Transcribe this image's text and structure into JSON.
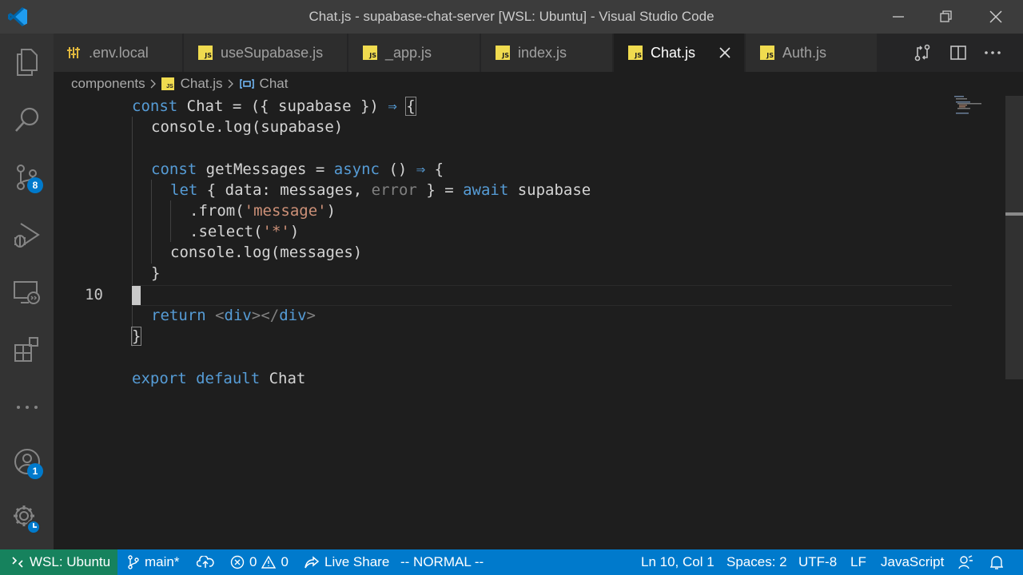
{
  "window": {
    "title": "Chat.js - supabase-chat-server [WSL: Ubuntu] - Visual Studio Code"
  },
  "activity_bar": {
    "scm_badge": "8",
    "accounts_badge": "1"
  },
  "tabs": [
    {
      "label": ".env.local",
      "icon": "settings-file-icon",
      "active": false
    },
    {
      "label": "useSupabase.js",
      "icon": "js-file-icon",
      "active": false
    },
    {
      "label": "_app.js",
      "icon": "js-file-icon",
      "active": false
    },
    {
      "label": "index.js",
      "icon": "js-file-icon",
      "active": false
    },
    {
      "label": "Chat.js",
      "icon": "js-file-icon",
      "active": true
    },
    {
      "label": "Auth.js",
      "icon": "js-file-icon",
      "active": false
    }
  ],
  "js_badge": "JS",
  "breadcrumb": {
    "folder": "components",
    "file": "Chat.js",
    "symbol": "Chat"
  },
  "editor": {
    "line_number": "10",
    "lines": {
      "l1": {
        "k1": "const",
        "t1": " Chat = ({ supabase }) ",
        "t2": "⇒",
        "t3": " ",
        "b": "{"
      },
      "l2": {
        "t1": "console.log(supabase)"
      },
      "l4": {
        "k1": "const",
        "t1": " getMessages = ",
        "k2": "async",
        "t2": " () ",
        "t3": "⇒",
        "t4": " {"
      },
      "l5": {
        "k1": "let",
        "t1": " { data: messages, ",
        "d1": "error",
        "t2": " } = ",
        "k2": "await",
        "t3": " supabase"
      },
      "l6": {
        "t1": ".from(",
        "s1": "'message'",
        "t2": ")"
      },
      "l7": {
        "t1": ".select(",
        "s1": "'*'",
        "t2": ")"
      },
      "l8": {
        "t1": "console.log(messages)"
      },
      "l9": {
        "t1": "}"
      },
      "l11": {
        "k1": "return",
        "t1": " ",
        "g1": "<",
        "n1": "div",
        "g2": "></",
        "n2": "div",
        "g3": ">"
      },
      "l12": {
        "b": "}"
      },
      "l14": {
        "k1": "export",
        "t1": " ",
        "k2": "default",
        "t2": " Chat"
      }
    }
  },
  "statusbar": {
    "remote": "WSL: Ubuntu",
    "branch": "main*",
    "errors": "0",
    "warnings": "0",
    "live_share": "Live Share",
    "mode": "-- NORMAL --",
    "position": "Ln 10, Col 1",
    "spaces": "Spaces: 2",
    "encoding": "UTF-8",
    "eol": "LF",
    "language": "JavaScript"
  },
  "colors": {
    "titlebar": "#3c3c3c",
    "activity_bar": "#333333",
    "editor_bg": "#1e1e1e",
    "statusbar": "#007acc",
    "remote": "#16825d",
    "keyword": "#569cd6",
    "string": "#ce9178",
    "js_icon": "#f0db4f"
  }
}
